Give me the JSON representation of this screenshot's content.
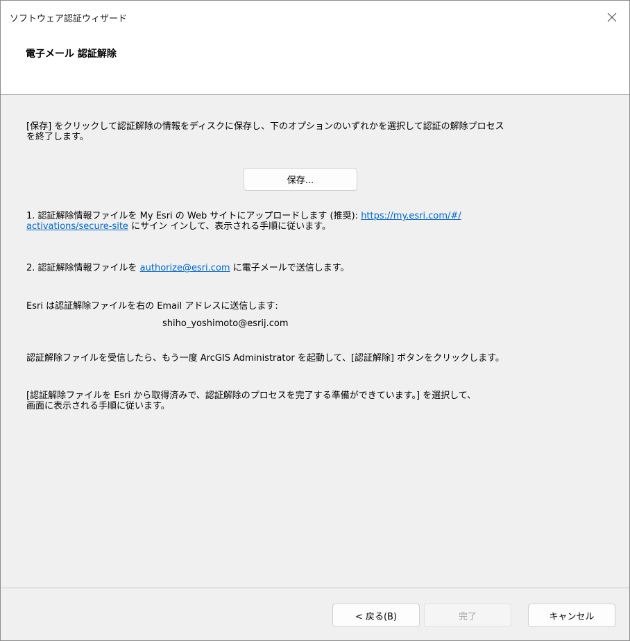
{
  "window": {
    "title": "ソフトウェア認証ウィザード"
  },
  "header": {
    "title": "電子メール 認証解除"
  },
  "content": {
    "intro_line1": "[保存] をクリックして認証解除の情報をディスクに保存し、下のオプションのいずれかを選択して認証の解除プロセス",
    "intro_line2": "を終了します。",
    "save_button": "保存...",
    "option1_prefix": "1. 認証解除情報ファイルを My Esri の Web サイトにアップロードします (推奨): ",
    "option1_link_part1": "https://my.esri.com/#/",
    "option1_link_part2": "activations/secure-site",
    "option1_suffix": " にサイン インして、表示される手順に従います。",
    "option2_prefix": "2. 認証解除情報ファイルを ",
    "option2_link": "authorize@esri.com",
    "option2_suffix": " に電子メールで送信します。",
    "email_note": "Esri は認証解除ファイルを右の Email アドレスに送信します:",
    "email_address": "shiho_yoshimoto@esrij.com",
    "after_receive": "認証解除ファイルを受信したら、もう一度 ArcGIS Administrator を起動して、[認証解除] ボタンをクリックします。",
    "final_line1": "[認証解除ファイルを Esri から取得済みで、認証解除のプロセスを完了する準備ができています。] を選択して、",
    "final_line2": "画面に表示される手順に従います。"
  },
  "footer": {
    "back_label": "< 戻る(B)",
    "finish_label": "完了",
    "cancel_label": "キャンセル"
  },
  "icons": {
    "close": "close-icon"
  },
  "colors": {
    "link": "#0066cc",
    "disabled_text": "#a0a0a0"
  }
}
